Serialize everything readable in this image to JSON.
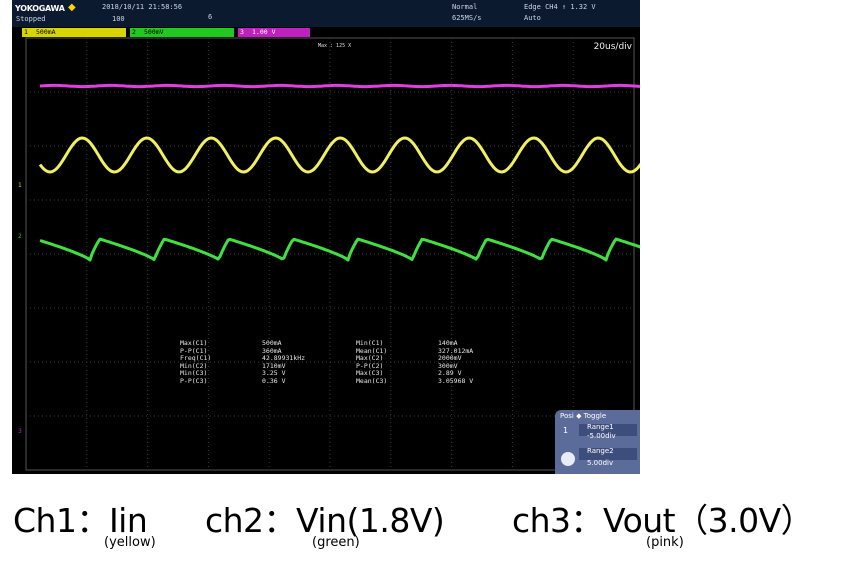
{
  "scope": {
    "brand": "YOKOGAWA",
    "datetime": "2018/10/11 21:58:56",
    "top_left_status": "Stopped",
    "acq_count": "100",
    "mode": "Normal",
    "sample_rate": "625MS/s",
    "trigger": "Edge CH4 ↑ 1.32 V",
    "trigger_mode": "Auto",
    "channels": [
      {
        "num": "1",
        "label": "500mA",
        "color": "#d8d400"
      },
      {
        "num": "2",
        "label": "500mV",
        "color": "#20c820"
      },
      {
        "num": "3",
        "label": "1.00 V",
        "color": "#c020c0"
      }
    ],
    "max_label": "Max : 125 X",
    "timebase": "20us/div",
    "measurements": {
      "col1_labels": [
        "Max(C1)",
        "P-P(C1)",
        "Freq(C1)",
        "Min(C2)",
        "Min(C3)",
        "P-P(C3)"
      ],
      "col1_values": [
        "500mA",
        "360mA",
        "42.89931kHz",
        "1710mV",
        "3.25 V",
        "0.36 V"
      ],
      "col2_labels": [
        "Min(C1)",
        "Mean(C1)",
        "Max(C2)",
        "P-P(C2)",
        "Max(C3)",
        "Mean(C3)"
      ],
      "col2_values": [
        "140mA",
        "327.012mA",
        "2000mV",
        "300mV",
        "2.89 V",
        "3.05968 V"
      ]
    },
    "zoom_panel": {
      "title": "Posi ◆ Toggle",
      "range1_label": "Range1",
      "range1_value": "-5.00div",
      "range2_label": "Range2",
      "range2_value": "5.00div"
    },
    "waveform_colors": {
      "ch1": "#f0f060",
      "ch2": "#40e040",
      "ch3": "#e040e0"
    }
  },
  "captions": {
    "ch1": "Ch1：Iin",
    "ch1_sub": "(yellow)",
    "ch2": "ch2：Vin(1.8V)",
    "ch2_sub": "(green)",
    "ch3": "ch3：Vout（3.0V）",
    "ch3_sub": "(pink)"
  }
}
